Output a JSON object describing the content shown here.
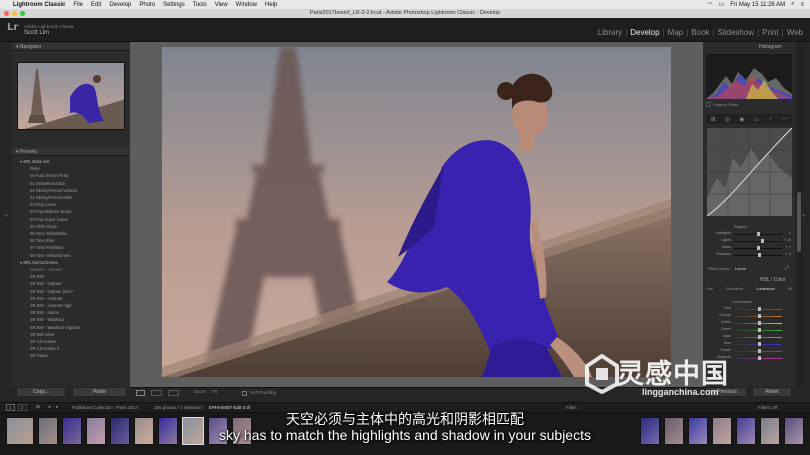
{
  "menubar": {
    "app": "Lightroom Classic",
    "items": [
      "File",
      "Edit",
      "Develop",
      "Photo",
      "Settings",
      "Tools",
      "View",
      "Window",
      "Help"
    ],
    "clock": "Fri May 15 11:26 AM"
  },
  "window": {
    "title": "Paris2017bestof_LR-2-2.lrcat - Adobe Photoshop Lightroom Classic - Develop"
  },
  "identity": {
    "logo": "Lr",
    "app": "Adobe Lightroom Classic",
    "user": "Scott Lim"
  },
  "modules": [
    "Library",
    "Develop",
    "Map",
    "Book",
    "Slideshow",
    "Print",
    "Web"
  ],
  "active_module": "Develop",
  "left_panel": {
    "navigator_title": "Navigator",
    "presets_title": "Presets",
    "folders": [
      {
        "name": "SRL Base Set",
        "items": [
          "Peter",
          "00 Auto (Reset First)",
          "01 NoiseReduction",
          "02 SkinnyPortrait Vertical",
          "02 SkinnyPortrait Wide",
          "03 Flop Curve",
          "03 Pop Midtone Bump",
          "03 Pop Super Duper",
          "04 HDR Clean",
          "05 Tone Yellow/Blue",
          "06 Tone Blue",
          "07 Tone Pink/Blue",
          "08 Tone Yellow/Green"
        ]
      },
      {
        "name": "SRL MonoChrome",
        "items": [
          "Generic - Zeroed",
          "SR BW",
          "SR BW - brighter",
          "SR BW - brighter plus**",
          "SR BW - contrast",
          "SR BW - contrast high",
          "SR BW - darker",
          "SR BW - Washout",
          "SR BW - Washout Vignette",
          "SR BW silver",
          "SR Chocolate",
          "SR Chocolate 2",
          "SR Sepia"
        ]
      }
    ],
    "copy_label": "Copy...",
    "paste_label": "Paste"
  },
  "toolbar": {
    "zoom_label": "Zoom",
    "fit_label": "Fit",
    "soft_proofing": "Soft Proofing"
  },
  "right_panel": {
    "histogram_title": "Histogram",
    "original_photo": "Original Photo",
    "region_title": "Region",
    "sliders": [
      {
        "label": "Highlights",
        "value": "0",
        "level": 0.5
      },
      {
        "label": "Lights",
        "value": "+ 18",
        "level": 0.6
      },
      {
        "label": "Darks",
        "value": "+ 1",
        "level": 0.51
      },
      {
        "label": "Shadows",
        "value": "+ 4",
        "level": 0.53
      }
    ],
    "point_curve_label": "Point Curve :",
    "point_curve_value": "Linear",
    "hsl_title": "HSL / Color",
    "hsl_tabs": [
      "Hue",
      "Saturation",
      "Luminance",
      "All"
    ],
    "luminance_title": "Luminance",
    "colors": [
      "Red",
      "Orange",
      "Yellow",
      "Green",
      "Aqua",
      "Blue",
      "Purple",
      "Magenta"
    ],
    "previous_label": "Previous",
    "reset_label": "Reset"
  },
  "filmstrip": {
    "pages": [
      "1",
      "2"
    ],
    "source": "Published Collection : Paris 2017",
    "count": "155 photos / 1 selected /",
    "file": "EPHHS807-Edit-3.tif",
    "filter_label": "Filter :",
    "filter_value": "Filters Off"
  },
  "subtitle": {
    "cn": "天空必须与主体中的高光和阴影相匹配",
    "en": "sky has to match the highlights and shadow in your subjects"
  },
  "watermark": {
    "text": "灵感中国",
    "url": "lingganchina.com"
  }
}
